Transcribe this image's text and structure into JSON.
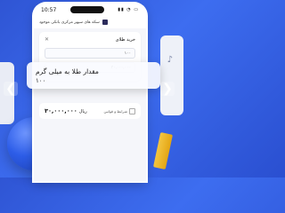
{
  "status_bar": {
    "time": "10:57",
    "icons": "▮▮ ◔ ▭"
  },
  "banner": {
    "text": "سکه های سپهر مرکزی بانکی موجود"
  },
  "card": {
    "title": "خرید طلای",
    "amount_placeholder": "۱۰۰",
    "amount_value": "۳۰,۰۰۰,۰۰۰"
  },
  "overlay": {
    "label": "مقدار طلا به میلی گرم",
    "value": "۱۰۰"
  },
  "footer": {
    "price_value": "۳۰,۰۰۰,۰۰۰",
    "price_unit": "ریال",
    "terms_text": "شرایط و قوانین"
  },
  "icons": {
    "left_arrow": "❮",
    "right_arrow": "❯",
    "close": "✕",
    "music": "♪"
  },
  "colors": {
    "background": "#3d6df0",
    "accent_gold": "#e3a514"
  }
}
